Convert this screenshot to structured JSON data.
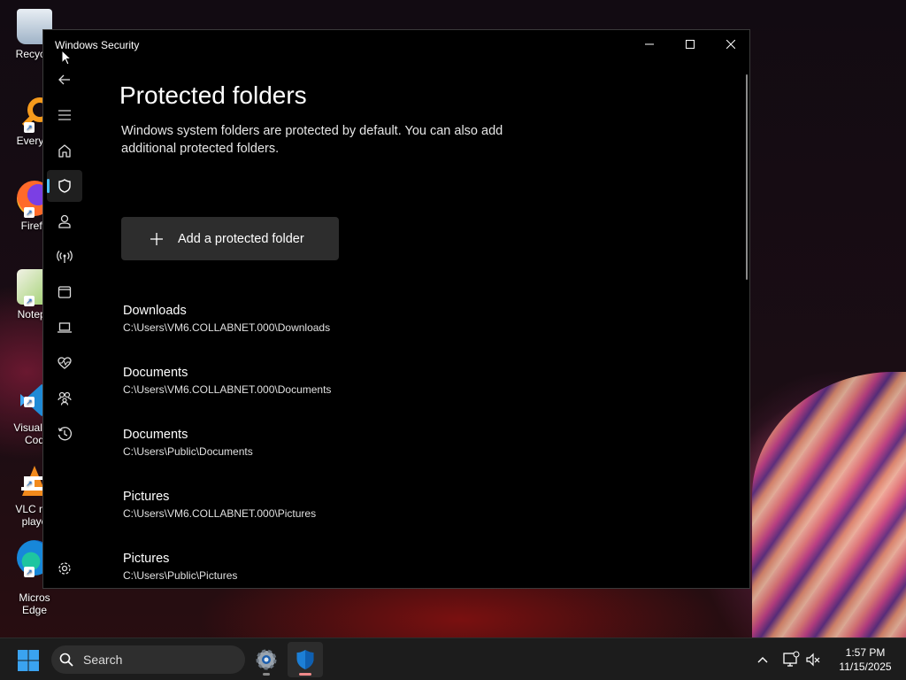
{
  "desktop": {
    "icons": [
      {
        "label": "Recycle",
        "icon": "recycle-bin-icon"
      },
      {
        "label": "Everyth",
        "icon": "everything-search-icon"
      },
      {
        "label": "Firefo",
        "icon": "firefox-icon"
      },
      {
        "label": "Notepa",
        "icon": "notepad-plus-plus-icon"
      },
      {
        "label": "Visual St\nCod",
        "icon": "vscode-icon"
      },
      {
        "label": "VLC me\nplaye",
        "icon": "vlc-icon"
      },
      {
        "label": "Micros\nEdge",
        "icon": "edge-icon"
      }
    ]
  },
  "window": {
    "title": "Windows Security",
    "controls": {
      "minimize": "minimize-icon",
      "maximize": "maximize-icon",
      "close": "close-icon"
    }
  },
  "nav": {
    "items": [
      {
        "name": "back",
        "icon": "back-arrow-icon"
      },
      {
        "name": "menu",
        "icon": "hamburger-menu-icon"
      },
      {
        "name": "home",
        "icon": "home-icon"
      },
      {
        "name": "virus-threat-protection",
        "icon": "shield-icon",
        "active": true
      },
      {
        "name": "account-protection",
        "icon": "person-icon"
      },
      {
        "name": "firewall-network",
        "icon": "wireless-antenna-icon"
      },
      {
        "name": "app-browser-control",
        "icon": "browser-window-icon"
      },
      {
        "name": "device-security",
        "icon": "laptop-icon"
      },
      {
        "name": "device-performance-health",
        "icon": "heart-pulse-icon"
      },
      {
        "name": "family-options",
        "icon": "family-icon"
      },
      {
        "name": "protection-history",
        "icon": "history-icon"
      },
      {
        "name": "settings",
        "icon": "gear-icon"
      }
    ],
    "accent": "#4cc2ff"
  },
  "main": {
    "title": "Protected folders",
    "description": "Windows system folders are protected by default. You can also add additional protected folders.",
    "add_button": "Add a protected folder",
    "folders": [
      {
        "name": "Downloads",
        "path": "C:\\Users\\VM6.COLLABNET.000\\Downloads"
      },
      {
        "name": "Documents",
        "path": "C:\\Users\\VM6.COLLABNET.000\\Documents"
      },
      {
        "name": "Documents",
        "path": "C:\\Users\\Public\\Documents"
      },
      {
        "name": "Pictures",
        "path": "C:\\Users\\VM6.COLLABNET.000\\Pictures"
      },
      {
        "name": "Pictures",
        "path": "C:\\Users\\Public\\Pictures"
      }
    ]
  },
  "taskbar": {
    "search_label": "Search",
    "apps": [
      {
        "name": "settings",
        "icon": "settings-gear-icon"
      },
      {
        "name": "windows-security",
        "icon": "windows-security-shield-icon",
        "active": true
      }
    ],
    "tray": [
      {
        "name": "show-hidden",
        "icon": "chevron-up-icon"
      },
      {
        "name": "network",
        "icon": "network-disconnected-icon"
      },
      {
        "name": "volume",
        "icon": "volume-muted-icon"
      }
    ],
    "time": "1:57 PM",
    "date": "11/15/2025"
  }
}
